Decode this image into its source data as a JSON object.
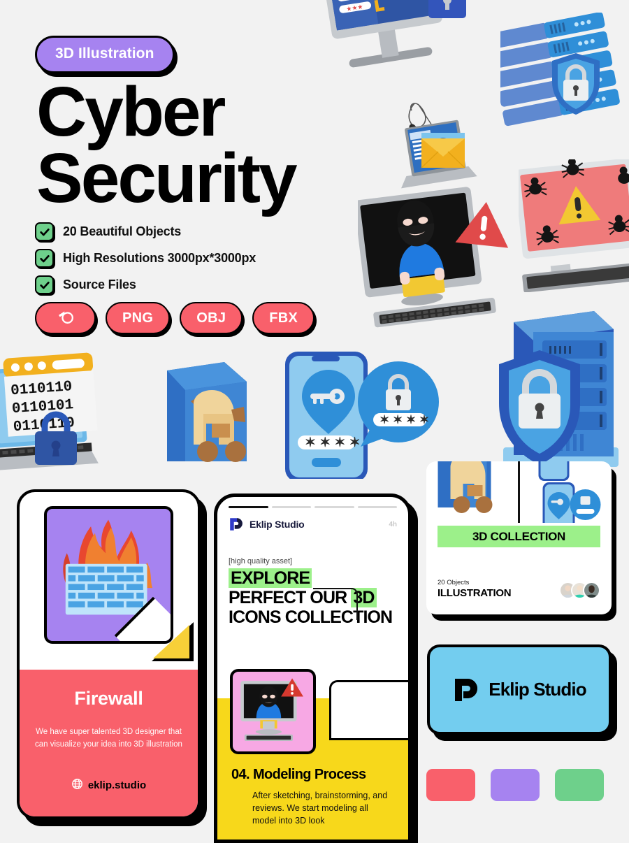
{
  "theme": {
    "background": "#f2f2f2",
    "accent_purple": "#a683f0",
    "accent_red": "#f9606b",
    "accent_green": "#6ed08b",
    "highlight_green": "#9cf08a",
    "accent_yellow": "#f7d81b",
    "accent_blue": "#73cdef",
    "accent_pink": "#f7a8e4",
    "ink": "#000000"
  },
  "hero": {
    "badge": "3D Illustration",
    "title_line1": "Cyber",
    "title_line2": "Security",
    "features": [
      {
        "icon": "check-icon",
        "label": "20 Beautiful Objects"
      },
      {
        "icon": "check-icon",
        "label": "High Resolutions 3000px*3000px"
      },
      {
        "icon": "check-icon",
        "label": "Source Files"
      }
    ],
    "formats": [
      {
        "icon": "blender-icon",
        "label": ""
      },
      {
        "icon": "",
        "label": "PNG"
      },
      {
        "icon": "",
        "label": "OBJ"
      },
      {
        "icon": "",
        "label": "FBX"
      }
    ]
  },
  "artwork": {
    "items": [
      "monitor-fingerprint-login-lock",
      "server-stack-shield-lock",
      "phishing-email-laptop-hook",
      "hacker-in-monitor-warning",
      "bug-infested-monitor-warning",
      "binary-laptop-lock",
      "trojan-horse",
      "phone-key-pin-password",
      "server-tower-shield-lock"
    ]
  },
  "firewall_card": {
    "title": "Firewall",
    "description": "We have super talented 3D designer that can visualize your idea into 3D illustration",
    "url_icon": "globe-icon",
    "url": "eklip.studio",
    "image_alt": "firewall-brick-flame-illustration"
  },
  "phone_mockup": {
    "story_bars": 4,
    "active_bar": 1,
    "brand": "Eklip Studio",
    "logo_icon": "eklip-logo-icon",
    "time": "4h",
    "kicker": "[high quality asset]",
    "headline_part1": "EXPLORE",
    "headline_part2": "PERFECT OUR ",
    "headline_part3": "3D",
    "headline_part4": "ICONS COLLECTION",
    "step_title": "04. Modeling Process",
    "step_description": "After sketching, brainstorming, and reviews. We start modeling all model into 3D look",
    "thumb_alt": "hacker-in-monitor-thumbnail"
  },
  "collection_card": {
    "banner": "3D COLLECTION",
    "objects_count": "20 Objects",
    "category": "ILLUSTRATION",
    "avatars": 3,
    "image_left_alt": "trojan-horse-thumbnail",
    "image_right_alt": "phone-key-password-thumbnail"
  },
  "studio_card": {
    "logo_icon": "eklip-logo-icon",
    "name": "Eklip Studio"
  },
  "swatches": [
    {
      "name": "swatch-red",
      "color": "#f9606b"
    },
    {
      "name": "swatch-purple",
      "color": "#a683f0"
    },
    {
      "name": "swatch-green",
      "color": "#6ed08b"
    }
  ]
}
